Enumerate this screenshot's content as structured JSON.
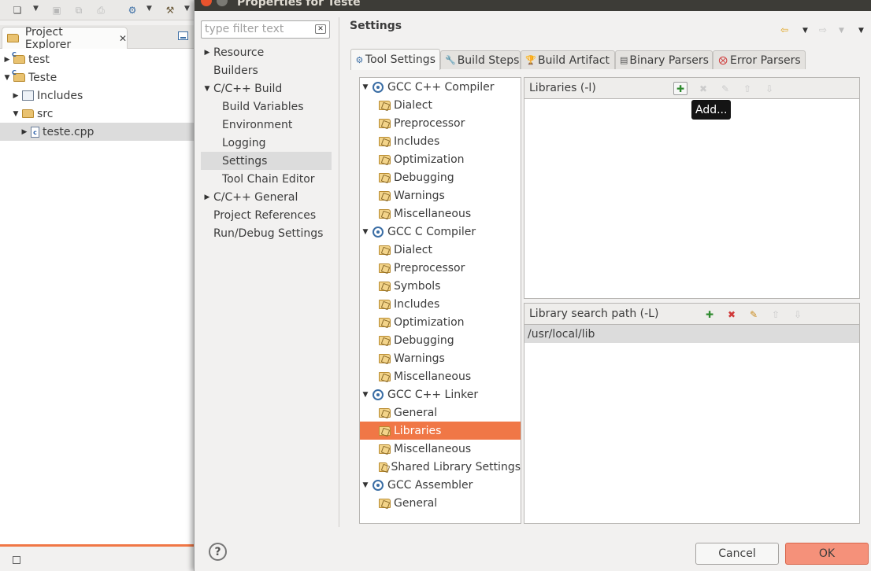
{
  "dialog": {
    "title": "Properties for Teste",
    "filter_placeholder": "type filter text",
    "page_title": "Settings",
    "nav": [
      {
        "label": "Resource",
        "expander": "collapsed"
      },
      {
        "label": "Builders",
        "expander": "none"
      },
      {
        "label": "C/C++ Build",
        "expander": "expanded"
      },
      {
        "label": "Build Variables",
        "expander": "child"
      },
      {
        "label": "Environment",
        "expander": "child"
      },
      {
        "label": "Logging",
        "expander": "child"
      },
      {
        "label": "Settings",
        "expander": "child",
        "selected": true
      },
      {
        "label": "Tool Chain Editor",
        "expander": "child"
      },
      {
        "label": "C/C++ General",
        "expander": "collapsed"
      },
      {
        "label": "Project References",
        "expander": "none"
      },
      {
        "label": "Run/Debug Settings",
        "expander": "none"
      }
    ],
    "tabs": [
      "Tool Settings",
      "Build Steps",
      "Build Artifact",
      "Binary Parsers",
      "Error Parsers"
    ],
    "active_tab": "Tool Settings",
    "tool_tree": [
      {
        "label": "GCC C++ Compiler",
        "kind": "tool"
      },
      {
        "label": "Dialect",
        "kind": "option"
      },
      {
        "label": "Preprocessor",
        "kind": "option"
      },
      {
        "label": "Includes",
        "kind": "option"
      },
      {
        "label": "Optimization",
        "kind": "option"
      },
      {
        "label": "Debugging",
        "kind": "option"
      },
      {
        "label": "Warnings",
        "kind": "option"
      },
      {
        "label": "Miscellaneous",
        "kind": "option"
      },
      {
        "label": "GCC C Compiler",
        "kind": "tool"
      },
      {
        "label": "Dialect",
        "kind": "option"
      },
      {
        "label": "Preprocessor",
        "kind": "option"
      },
      {
        "label": "Symbols",
        "kind": "option"
      },
      {
        "label": "Includes",
        "kind": "option"
      },
      {
        "label": "Optimization",
        "kind": "option"
      },
      {
        "label": "Debugging",
        "kind": "option"
      },
      {
        "label": "Warnings",
        "kind": "option"
      },
      {
        "label": "Miscellaneous",
        "kind": "option"
      },
      {
        "label": "GCC C++ Linker",
        "kind": "tool"
      },
      {
        "label": "General",
        "kind": "option"
      },
      {
        "label": "Libraries",
        "kind": "option",
        "selected": true
      },
      {
        "label": "Miscellaneous",
        "kind": "option"
      },
      {
        "label": "Shared Library Settings",
        "kind": "option"
      },
      {
        "label": "GCC Assembler",
        "kind": "tool"
      },
      {
        "label": "General",
        "kind": "option"
      }
    ],
    "libraries_label": "Libraries (-l)",
    "libraries": [],
    "tooltip": "Add...",
    "library_paths_label": "Library search path (-L)",
    "library_paths": [
      "/usr/local/lib"
    ],
    "cancel_label": "Cancel",
    "ok_label": "OK",
    "help_glyph": "?"
  },
  "project_explorer": {
    "tab_label": "Project Explorer",
    "items": [
      {
        "label": "test",
        "icon": "project-icon",
        "expander": "collapsed"
      },
      {
        "label": "Teste",
        "icon": "project-icon",
        "expander": "expanded"
      },
      {
        "label": "Includes",
        "icon": "includes-icon",
        "expander": "collapsed"
      },
      {
        "label": "src",
        "icon": "folder-icon",
        "expander": "expanded"
      },
      {
        "label": "teste.cpp",
        "icon": "cpp-file-icon",
        "expander": "collapsed",
        "selected": true
      }
    ]
  },
  "colors": {
    "accent": "#f07746",
    "ok_button": "#f5917a",
    "titlebar": "#3d3c37"
  }
}
